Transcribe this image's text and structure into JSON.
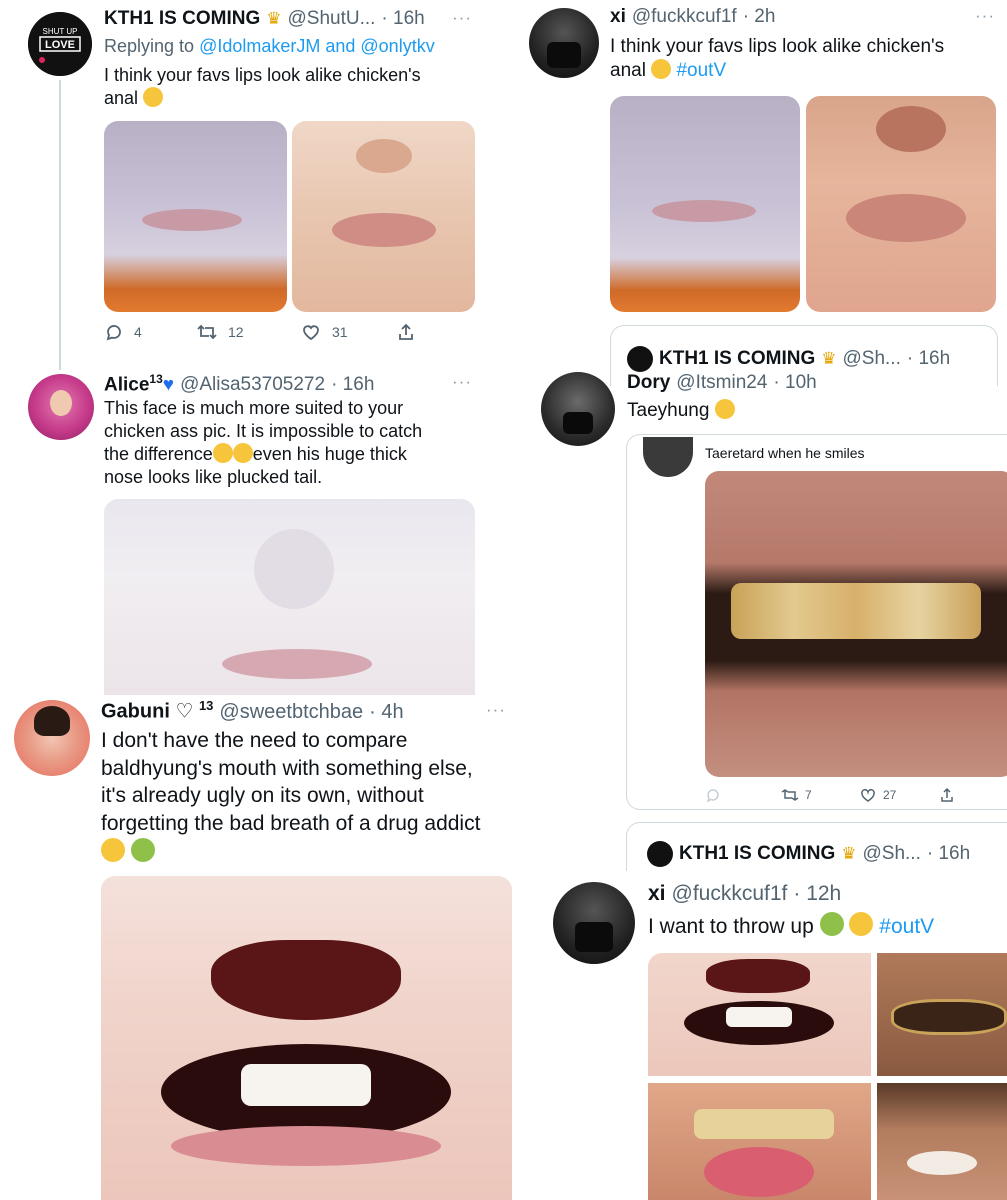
{
  "tweet1": {
    "name": "KTH1 IS COMING",
    "handle": "@ShutU...",
    "time": "· 16h",
    "more": "···",
    "replying_prefix": "Replying to",
    "replying_to": "@IdolmakerJM and @onlytkv",
    "text_line1": "I think your favs lips look alike chicken's",
    "text_line2": "anal",
    "replies": "4",
    "retweets": "12",
    "likes": "31",
    "avatar_text1": "SHUT UP",
    "avatar_text2": "LOVE"
  },
  "tweet2": {
    "name": "xi",
    "handle": "@fuckkcuf1f",
    "time": "· 2h",
    "more": "···",
    "text_line1": "I think your favs lips look alike chicken's",
    "text_line2": "anal",
    "hashtag": "#outV"
  },
  "quoted1": {
    "name": "KTH1 IS COMING",
    "handle": "@Sh...",
    "time": "· 16h"
  },
  "tweet3": {
    "name": "Alice",
    "sup": "13",
    "handle": "@Alisa53705272",
    "time": "· 16h",
    "more": "···",
    "line1": "This face is much more suited to your",
    "line2": "chicken ass pic. It is impossible to catch",
    "line3a": "the difference",
    "line3b": "even his huge thick",
    "line4": "nose looks like plucked tail."
  },
  "tweet4": {
    "name": "Dory",
    "handle": "@Itsmin24",
    "time": "· 10h",
    "text": "Taeyhung",
    "quote_text": "Taeretard when he smiles",
    "retweets": "7",
    "likes": "27"
  },
  "tweet5": {
    "name": "Gabuni",
    "sup": "13",
    "handle": "@sweetbtchbae",
    "time": "· 4h",
    "more": "···",
    "line1": "I don't have the need to compare",
    "line2": "baldhyung's mouth with something else,",
    "line3": "it's already ugly on its own, without",
    "line4": "forgetting the bad breath of a drug addict"
  },
  "quoted2": {
    "name": "KTH1 IS COMING",
    "handle": "@Sh...",
    "time": "· 16h"
  },
  "tweet6": {
    "name": "xi",
    "handle": "@fuckkcuf1f",
    "time": "· 12h",
    "text": "I want to throw up",
    "hashtag": "#outV"
  },
  "colors": {
    "link": "#1d9bf0",
    "secondary": "#536471",
    "border": "#cfd9de"
  }
}
